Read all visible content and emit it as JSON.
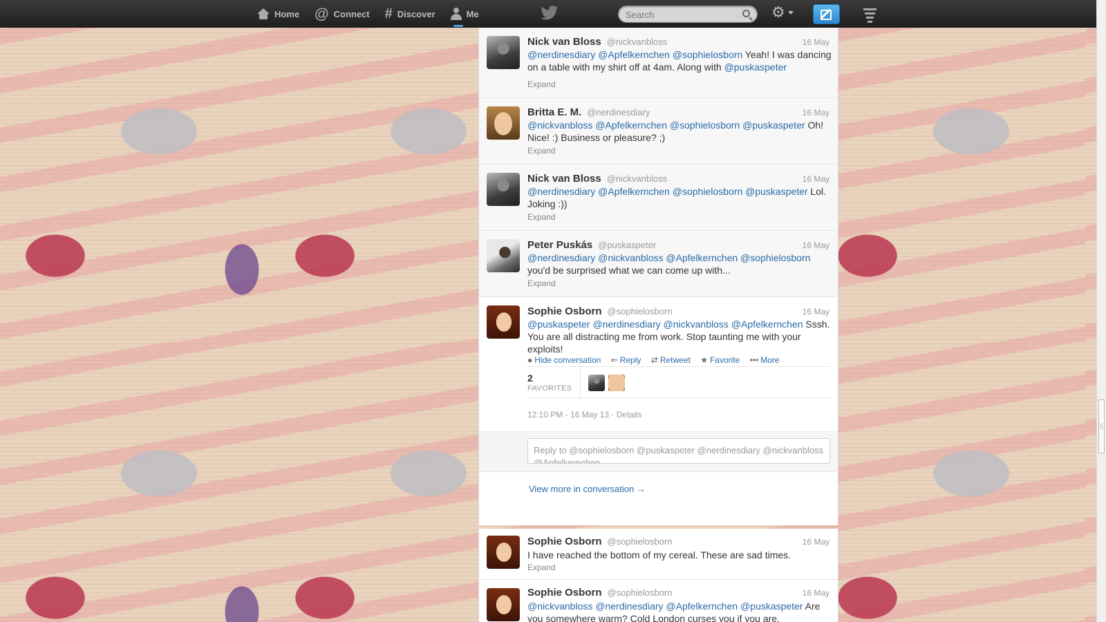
{
  "nav": {
    "home": "Home",
    "connect": "Connect",
    "discover": "Discover",
    "me": "Me"
  },
  "search": {
    "placeholder": "Search"
  },
  "icons": {
    "home": "house-icon",
    "connect": "at-icon",
    "discover": "hash-icon",
    "me": "person-icon",
    "logo": "twitter-bird-icon",
    "search": "search-icon",
    "settings": "gear-icon",
    "compose": "compose-icon",
    "menu": "hamburger-icon"
  },
  "glyphs": {
    "at": "@",
    "hash": "#",
    "gear": "⚙",
    "reply": "⇐",
    "retweet": "⇄",
    "favorite": "★",
    "more": "•••",
    "hide": "●",
    "arrow": "→"
  },
  "colors": {
    "link": "#2a6aa8",
    "topbar": "#2b2b2b",
    "compose": "#3ea1e4"
  },
  "tweets": [
    {
      "name": "Nick van Bloss",
      "handle": "@nickvanbloss",
      "date": "16 May",
      "mentions": [
        "@nerdinesdiary",
        "@Apfelkernchen",
        "@sophielosborn"
      ],
      "text": "Yeah! I was dancing on a table with my shirt off at 4am. Along with",
      "mention_end": "@puskaspeter",
      "expand": "Expand"
    },
    {
      "name": "Britta E. M.",
      "handle": "@nerdinesdiary",
      "date": "16 May",
      "mentions": [
        "@nickvanbloss",
        "@Apfelkernchen",
        "@sophielosborn",
        "@puskaspeter"
      ],
      "text": "Oh! Nice! :) Business or pleasure? ;)",
      "expand": "Expand"
    },
    {
      "name": "Nick van Bloss",
      "handle": "@nickvanbloss",
      "date": "16 May",
      "mentions": [
        "@nerdinesdiary",
        "@Apfelkernchen",
        "@sophielosborn",
        "@puskaspeter"
      ],
      "text": "Lol. Joking :))",
      "expand": "Expand"
    },
    {
      "name": "Peter Puskás",
      "handle": "@puskaspeter",
      "date": "16 May",
      "mentions": [
        "@nerdinesdiary",
        "@nickvanbloss",
        "@Apfelkernchen",
        "@sophielosborn"
      ],
      "text": "you'd be surprised what we can come up with...",
      "expand": "Expand"
    },
    {
      "name": "Sophie Osborn",
      "handle": "@sophielosborn",
      "date": "16 May",
      "mentions": [
        "@puskaspeter",
        "@nerdinesdiary",
        "@nickvanbloss",
        "@Apfelkernchen"
      ],
      "text": "Sssh.  You are all distracting me from work.  Stop taunting me with your exploits!",
      "actions": {
        "hide": "Hide conversation",
        "reply": "Reply",
        "retweet": "Retweet",
        "favorite": "Favorite",
        "more": "More"
      },
      "favorites_count": "2",
      "favorites_label": "FAVORITES",
      "timestamp": "12:10 PM - 16 May 13",
      "details": "Details",
      "reply_placeholder": "Reply to @sophielosborn @puskaspeter @nerdinesdiary @nickvanbloss @Apfelkernchen",
      "view_more": "View more in conversation"
    },
    {
      "name": "Sophie Osborn",
      "handle": "@sophielosborn",
      "date": "16 May",
      "text": "I have reached the bottom of my cereal.  These are sad times.",
      "expand": "Expand"
    },
    {
      "name": "Sophie Osborn",
      "handle": "@sophielosborn",
      "date": "16 May",
      "mentions": [
        "@nickvanbloss",
        "@nerdinesdiary",
        "@Apfelkernchen",
        "@puskaspeter"
      ],
      "text": "Are you somewhere warm?  Cold London curses you if you are."
    }
  ]
}
